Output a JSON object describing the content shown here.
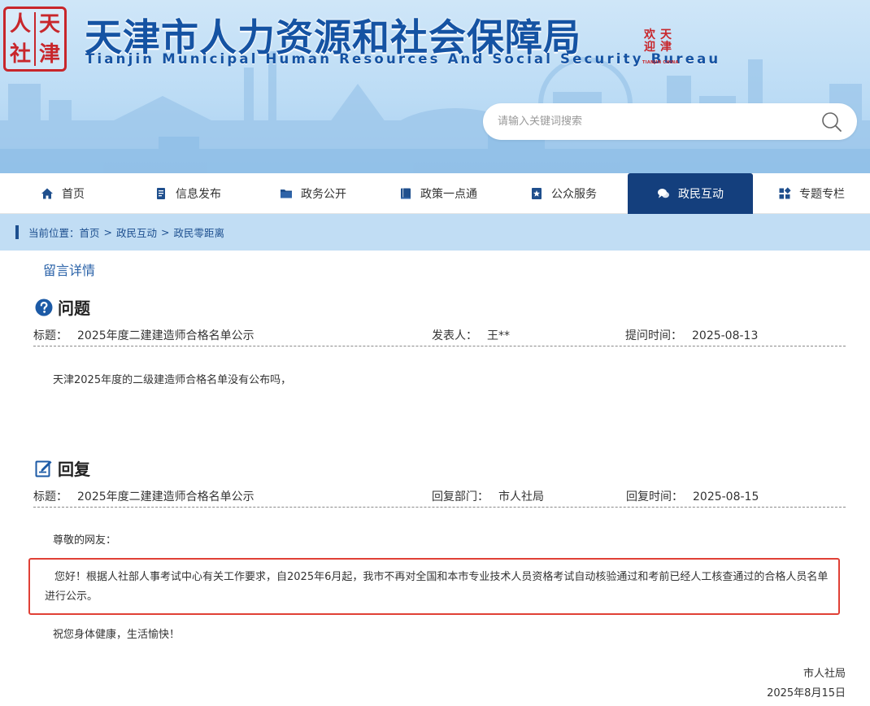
{
  "header": {
    "seal_left_chars": [
      "人",
      "天",
      "社",
      "津"
    ],
    "title": "天津市人力资源和社会保障局",
    "subtitle": "Tianjin Municipal Human Resources And Social Security Bureau",
    "seal_right_chars": [
      "天",
      "津",
      "欢",
      "迎"
    ],
    "seal_right_tiny": "TIANJIN CHINA",
    "search": {
      "placeholder": "请输入关键词搜索"
    }
  },
  "nav": {
    "items": [
      {
        "label": "首页",
        "icon": "home-icon"
      },
      {
        "label": "信息发布",
        "icon": "document-icon"
      },
      {
        "label": "政务公开",
        "icon": "folder-icon"
      },
      {
        "label": "政策一点通",
        "icon": "book-icon"
      },
      {
        "label": "公众服务",
        "icon": "star-badge-icon"
      },
      {
        "label": "政民互动",
        "icon": "chat-icon",
        "active": true
      },
      {
        "label": "专题专栏",
        "icon": "grid-icon"
      }
    ]
  },
  "breadcrumb": {
    "prefix": "当前位置：",
    "items": [
      "首页",
      "政民互动",
      "政民零距离"
    ],
    "separator": ">"
  },
  "detail": {
    "tab_label": "留言详情",
    "question": {
      "heading": "问题",
      "title_key": "标题：",
      "title_value": "2025年度二建建造师合格名单公示",
      "author_key": "发表人：",
      "author_value": "王**",
      "time_key": "提问时间：",
      "time_value": "2025-08-13",
      "body": "天津2025年度的二级建造师合格名单没有公布吗，"
    },
    "reply": {
      "heading": "回复",
      "title_key": "标题：",
      "title_value": "2025年度二建建造师合格名单公示",
      "dept_key": "回复部门：",
      "dept_value": "市人社局",
      "time_key": "回复时间：",
      "time_value": "2025-08-15",
      "greeting": "尊敬的网友：",
      "body": "您好！根据人社部人事考试中心有关工作要求，自2025年6月起，我市不再对全国和本市专业技术人员资格考试自动核验通过和考前已经人工核查通过的合格人员名单进行公示。",
      "closing": "祝您身体健康，生活愉快！",
      "signature": "市人社局",
      "date": "2025年8月15日"
    }
  },
  "colors": {
    "brand_blue": "#1553a3",
    "nav_active": "#143f7d",
    "crumb_bg": "#c1ddf4",
    "highlight_red": "#e04036"
  }
}
